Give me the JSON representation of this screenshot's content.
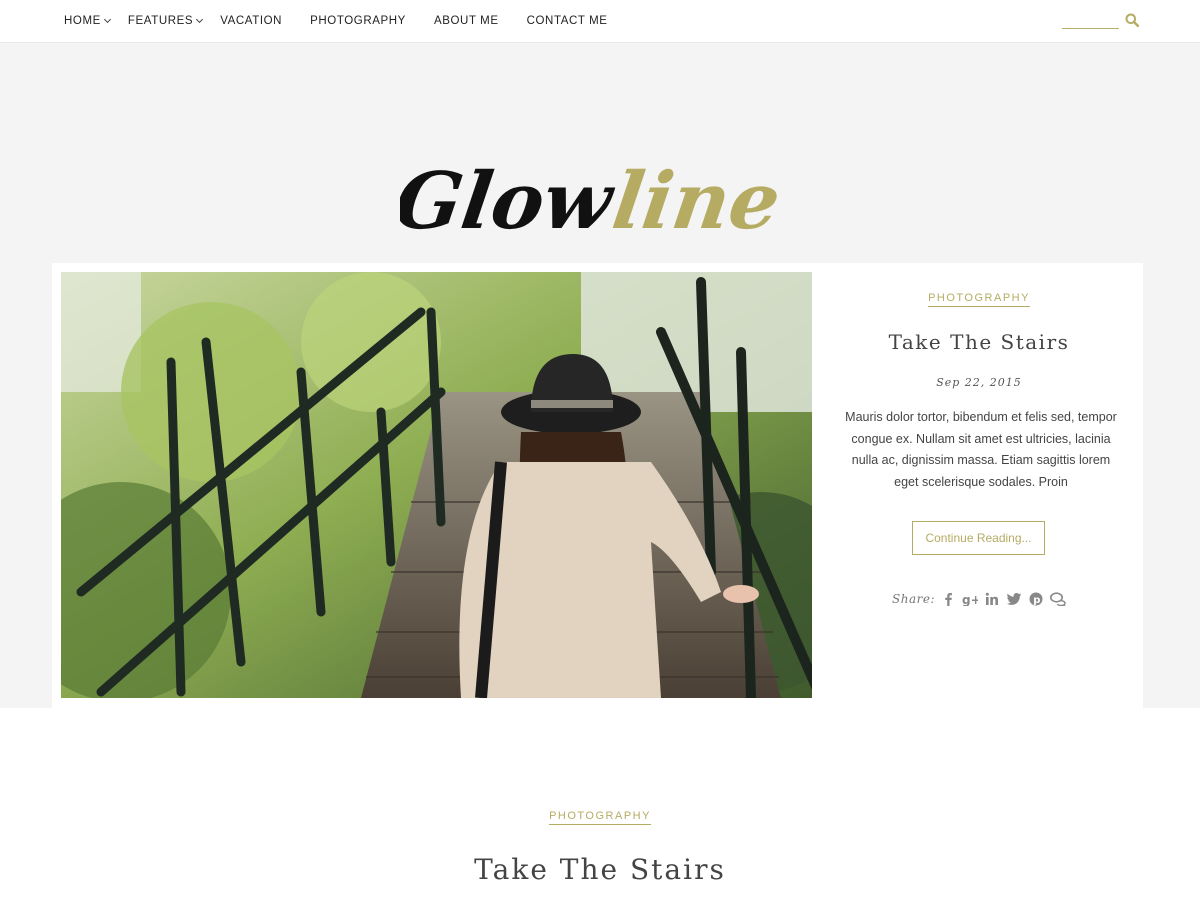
{
  "nav": {
    "items": [
      {
        "label": "HOME",
        "has_submenu": true
      },
      {
        "label": "FEATURES",
        "has_submenu": true
      },
      {
        "label": "VACATION",
        "has_submenu": false
      },
      {
        "label": "PHOTOGRAPHY",
        "has_submenu": false
      },
      {
        "label": "ABOUT ME",
        "has_submenu": false
      },
      {
        "label": "CONTACT ME",
        "has_submenu": false
      }
    ],
    "search_placeholder": "",
    "search_icon": "search-icon"
  },
  "brand": {
    "logo_part1": "Glow",
    "logo_part2": "line",
    "accent_color": "#b6ab63"
  },
  "featured": {
    "category": "PHOTOGRAPHY",
    "title": "Take The Stairs",
    "date": "Sep 22, 2015",
    "excerpt": "Mauris dolor tortor, bibendum et felis sed, tempor congue ex. Nullam sit amet est ultricies, lacinia nulla ac, dignissim massa. Etiam sagittis lorem eget scelerisque sodales. Proin",
    "button_label": "Continue Reading...",
    "share_label": "Share:",
    "share_icons": [
      "facebook-icon",
      "google-plus-icon",
      "linkedin-icon",
      "twitter-icon",
      "pinterest-icon",
      "comment-icon"
    ]
  },
  "post2": {
    "category": "PHOTOGRAPHY",
    "title": "Take The Stairs"
  }
}
